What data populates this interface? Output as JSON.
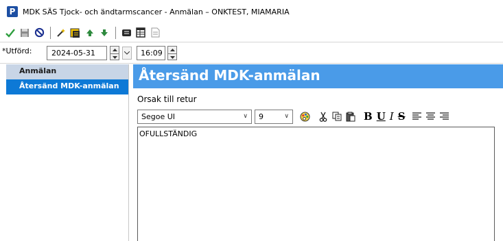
{
  "window": {
    "app_icon_letter": "P",
    "title": "MDK SÄS Tjock- och ändtarmscancer - Anmälan – ONKTEST, MIAMARIA"
  },
  "toolbar": {
    "buttons": [
      {
        "icon": "checkmark-icon",
        "color": "#2e9e3e"
      },
      {
        "icon": "save-icon",
        "color": "#7a7a7a"
      },
      {
        "icon": "cancel-icon",
        "color": "#1a2f8f"
      },
      {
        "icon": "edit-wand-icon",
        "color": "#333333"
      },
      {
        "icon": "form-highlight-icon",
        "color": "#e3b500"
      },
      {
        "icon": "arrow-up-icon",
        "color": "#2e8a3e"
      },
      {
        "icon": "arrow-down-icon",
        "color": "#2e8a3e"
      },
      {
        "icon": "message-icon",
        "color": "#333333"
      },
      {
        "icon": "table-icon",
        "color": "#333333"
      },
      {
        "icon": "document-icon",
        "color": "#9a9a9a"
      }
    ]
  },
  "dateRow": {
    "label": "*Utförd:",
    "date": "2024-05-31",
    "time": "16:09"
  },
  "sidebar": {
    "header": "Anmälan",
    "items": [
      {
        "label": "Återsänd MDK-anmälan",
        "active": true
      }
    ]
  },
  "main": {
    "heading": "Återsänd MDK-anmälan",
    "heading_color": "#4a9be8",
    "reason_label": "Orsak till retur",
    "format": {
      "font": "Segoe UI",
      "size": "9",
      "bold": "B",
      "underline": "U",
      "italic": "I",
      "strike": "S"
    },
    "text": "OFULLSTÄNDIG"
  }
}
